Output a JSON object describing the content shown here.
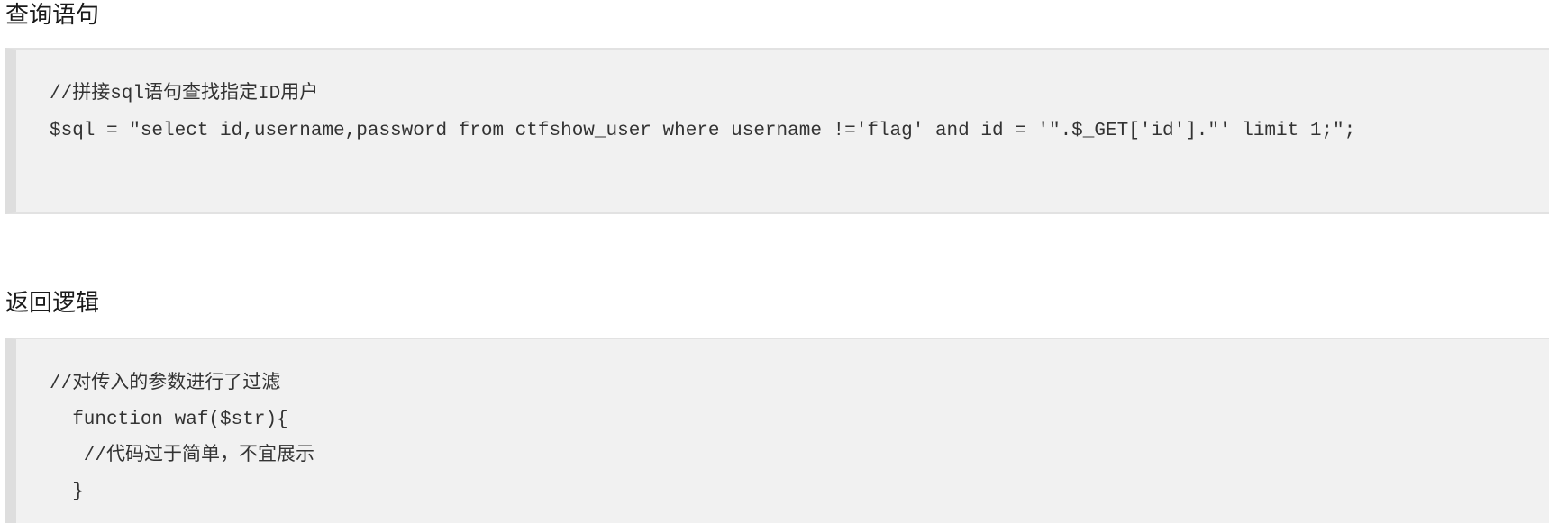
{
  "sections": [
    {
      "title": "查询语句",
      "lines": [
        "//拼接sql语句查找指定ID用户",
        "$sql = \"select id,username,password from ctfshow_user where username !='flag' and id = '\".$_GET['id'].\"' limit 1;\";"
      ]
    },
    {
      "title": "返回逻辑",
      "lines": [
        "//对传入的参数进行了过滤",
        "  function waf($str){",
        "   //代码过于简单，不宜展示",
        "  }"
      ]
    }
  ]
}
